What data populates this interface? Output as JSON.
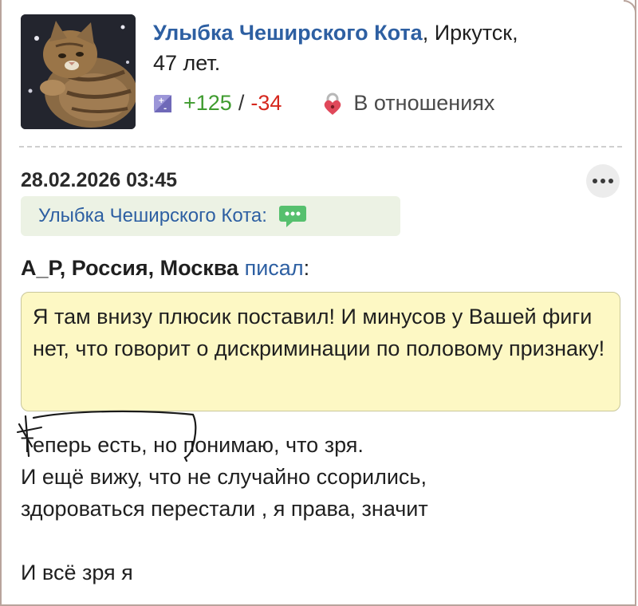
{
  "profile": {
    "name": "Улыбка Чеширского Кота",
    "name_suffix": ",",
    "location": " Иркутск,",
    "age": "47 лет.",
    "karma_plus": "+125",
    "karma_sep": "/",
    "karma_minus": "-34",
    "status": "В отношениях",
    "avatar_icon": "cat-photo"
  },
  "post": {
    "timestamp": "28.02.2026 03:45",
    "reply_to": "Улыбка Чеширского Кота:",
    "quote_author": "А_Р, Россия, Москва",
    "quote_link": "писал",
    "quote_colon": ":",
    "quote_text": "Я там внизу плюсик поставил! И минусов у Вашей фиги нет, что говорит о дискриминации по половому признаку!",
    "body_lines": [
      "Теперь есть, но понимаю, что зря.",
      "И ещё вижу, что не случайно ссорились,",
      "здороваться перестали , я права, значит",
      "И всё зря я"
    ]
  },
  "colors": {
    "link": "#2d5fa2",
    "plus": "#3f9b2f",
    "minus": "#d6281e",
    "quote_bg": "#fdf8c4",
    "reply_bg": "#ecf2e4"
  }
}
